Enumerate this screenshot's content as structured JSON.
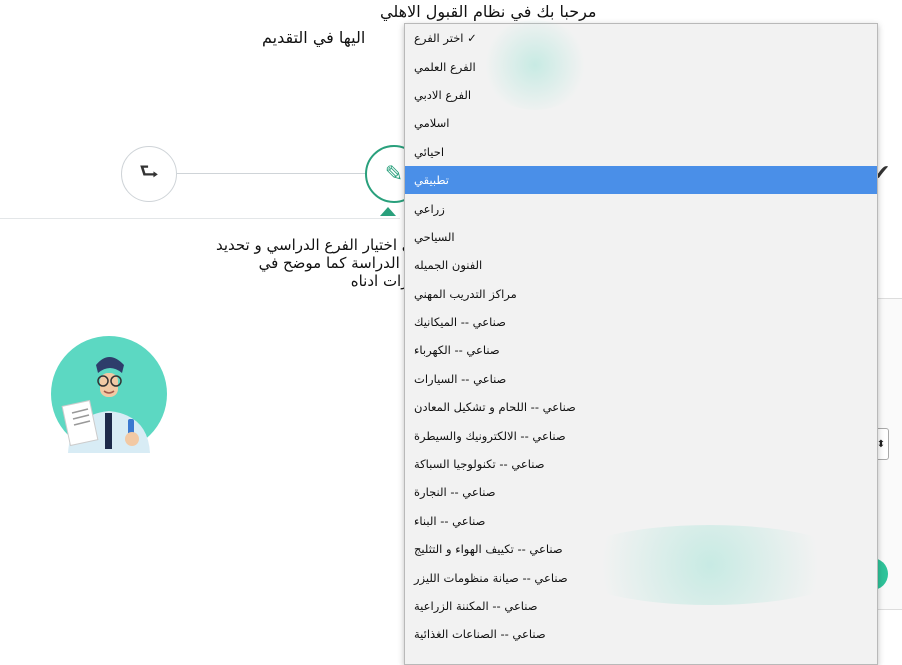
{
  "header": {
    "welcome": "مرحبا بك في نظام القبول الاهلي",
    "subtitle": "اليها في التقديم"
  },
  "steps": [
    {
      "icon": "sign-in-icon",
      "glyph": "⮑"
    },
    {
      "icon": "pencil-icon",
      "glyph": "✎",
      "active": true
    },
    {
      "icon": "check-icon",
      "glyph": "✔"
    }
  ],
  "instructions": "يرجى اختيار الفرع الدراسي و تحديد وجهة الدراسة كما موضح في الخيارات ادناه",
  "branch_select": {
    "selected_index": 0,
    "highlighted_index": 5,
    "options": [
      "اختر الفرع ✓",
      "الفرع العلمي",
      "الفرع الادبي",
      "اسلامي",
      "احيائي",
      "تطبيقي",
      "زراعي",
      "السياحي",
      "الفنون الجميله",
      "مراكز التدريب المهني",
      "صناعي -- الميكانيك",
      "صناعي -- الكهرباء",
      "صناعي -- السيارات",
      "صناعي -- اللحام و تشكيل المعادن",
      "صناعي -- الالكترونيك والسيطرة",
      "صناعي -- تكنولوجيا السباكة",
      "صناعي -- النجارة",
      "صناعي -- البناء",
      "صناعي -- تكييف الهواء و التثليج",
      "صناعي -- صيانة منظومات الليزر",
      "صناعي -- المكننة الزراعية",
      "صناعي -- الصناعات الغذائية"
    ]
  },
  "colors": {
    "accent": "#29a07c",
    "highlight": "#4a8fe8",
    "avatar_bg": "#5cd8c2"
  }
}
